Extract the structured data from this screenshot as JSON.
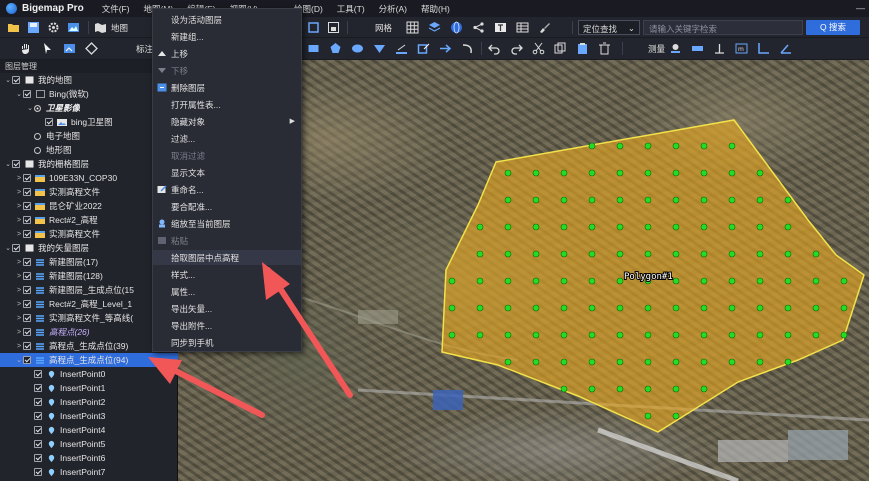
{
  "app": {
    "title": "Bigemap Pro"
  },
  "menu": [
    "文件(F)",
    "地图(M)",
    "编辑(E)",
    "视图(V)",
    "绘图(D)",
    "工具(T)",
    "分析(A)",
    "帮助(H)"
  ],
  "toolbar": {
    "map_label": "地图",
    "mark_label": "标注",
    "grid_label": "网格",
    "measure_label": "测量",
    "locate_select": "定位查找",
    "search_placeholder": "请输入关键字检索",
    "search_button": "Q 搜索"
  },
  "panel": {
    "title": "图层管理",
    "rows": [
      {
        "label": "我的地图",
        "indent": 0,
        "exp": "⌄",
        "type": "group"
      },
      {
        "label": "Bing(微软)",
        "indent": 1,
        "exp": "⌄",
        "type": "folder"
      },
      {
        "label": "卫星影像",
        "indent": 2,
        "exp": "⌄",
        "type": "radio-on"
      },
      {
        "label": "bing卫星图",
        "indent": 3,
        "exp": "",
        "type": "image"
      },
      {
        "label": "电子地图",
        "indent": 2,
        "exp": "",
        "type": "radio"
      },
      {
        "label": "地形图",
        "indent": 2,
        "exp": "",
        "type": "radio"
      },
      {
        "label": "我的栅格图层",
        "indent": 0,
        "exp": "⌄",
        "type": "group"
      },
      {
        "label": "109E33N_COP30",
        "indent": 1,
        "exp": ">",
        "type": "raster"
      },
      {
        "label": "实测高程文件",
        "indent": 1,
        "exp": ">",
        "type": "raster"
      },
      {
        "label": "昆仑矿业2022",
        "indent": 1,
        "exp": ">",
        "type": "raster"
      },
      {
        "label": "Rect#2_高程",
        "indent": 1,
        "exp": ">",
        "type": "raster"
      },
      {
        "label": "实测高程文件",
        "indent": 1,
        "exp": ">",
        "type": "raster"
      },
      {
        "label": "我的矢量图层",
        "indent": 0,
        "exp": "⌄",
        "type": "group"
      },
      {
        "label": "新建图层(17)",
        "indent": 1,
        "exp": ">",
        "type": "vector"
      },
      {
        "label": "新建图层(128)",
        "indent": 1,
        "exp": ">",
        "type": "vector"
      },
      {
        "label": "新建图层_生成点位(15",
        "indent": 1,
        "exp": ">",
        "type": "vector"
      },
      {
        "label": "Rect#2_高程_Level_1",
        "indent": 1,
        "exp": ">",
        "type": "vector"
      },
      {
        "label": "实测高程文件_等高线(",
        "indent": 1,
        "exp": ">",
        "type": "vector"
      },
      {
        "label": "高程点(26)",
        "indent": 1,
        "exp": ">",
        "type": "vector-italic"
      },
      {
        "label": "高程点_生成点位(39)",
        "indent": 1,
        "exp": ">",
        "type": "vector"
      },
      {
        "label": "高程点_生成点位(94)",
        "indent": 1,
        "exp": "⌄",
        "type": "vector-selected"
      },
      {
        "label": "InsertPoint0",
        "indent": 2,
        "exp": "",
        "type": "point"
      },
      {
        "label": "InsertPoint1",
        "indent": 2,
        "exp": "",
        "type": "point"
      },
      {
        "label": "InsertPoint2",
        "indent": 2,
        "exp": "",
        "type": "point"
      },
      {
        "label": "InsertPoint3",
        "indent": 2,
        "exp": "",
        "type": "point"
      },
      {
        "label": "InsertPoint4",
        "indent": 2,
        "exp": "",
        "type": "point"
      },
      {
        "label": "InsertPoint5",
        "indent": 2,
        "exp": "",
        "type": "point"
      },
      {
        "label": "InsertPoint6",
        "indent": 2,
        "exp": "",
        "type": "point"
      },
      {
        "label": "InsertPoint7",
        "indent": 2,
        "exp": "",
        "type": "point"
      }
    ]
  },
  "context_menu": {
    "items": [
      {
        "label": "设为活动图层",
        "disabled": false,
        "icon": "none"
      },
      {
        "label": "新建组...",
        "disabled": false,
        "icon": "none"
      },
      {
        "label": "上移",
        "disabled": false,
        "icon": "up-icon"
      },
      {
        "label": "下移",
        "disabled": true,
        "icon": "down-icon"
      },
      {
        "label": "删除图层",
        "disabled": false,
        "icon": "delete-icon"
      },
      {
        "label": "打开属性表...",
        "disabled": false,
        "icon": "none"
      },
      {
        "label": "隐藏对象",
        "disabled": false,
        "icon": "none",
        "submenu": true
      },
      {
        "label": "过滤...",
        "disabled": false,
        "icon": "none"
      },
      {
        "label": "取消过滤",
        "disabled": true,
        "icon": "none"
      },
      {
        "label": "显示文本",
        "disabled": false,
        "icon": "none"
      },
      {
        "label": "重命名...",
        "disabled": false,
        "icon": "edit-icon"
      },
      {
        "label": "要合配准...",
        "disabled": false,
        "icon": "none"
      },
      {
        "label": "缩放至当前图层",
        "disabled": false,
        "icon": "zoom-icon"
      },
      {
        "label": "粘贴",
        "disabled": true,
        "icon": "paste-icon"
      },
      {
        "label": "拾取图层中点高程",
        "disabled": false,
        "icon": "none",
        "hover": true
      },
      {
        "label": "样式...",
        "disabled": false,
        "icon": "none"
      },
      {
        "label": "属性...",
        "disabled": false,
        "icon": "none"
      },
      {
        "label": "导出矢量...",
        "disabled": false,
        "icon": "none"
      },
      {
        "label": "导出附件...",
        "disabled": false,
        "icon": "none"
      },
      {
        "label": "同步到手机",
        "disabled": false,
        "icon": "none"
      }
    ]
  },
  "map": {
    "polygon_label": "Polygon#1",
    "polygon_fill": "#e8a820",
    "point_color": "#22dd22"
  },
  "colors": {
    "accent": "#2f6cdc",
    "arrow": "#f25757"
  }
}
